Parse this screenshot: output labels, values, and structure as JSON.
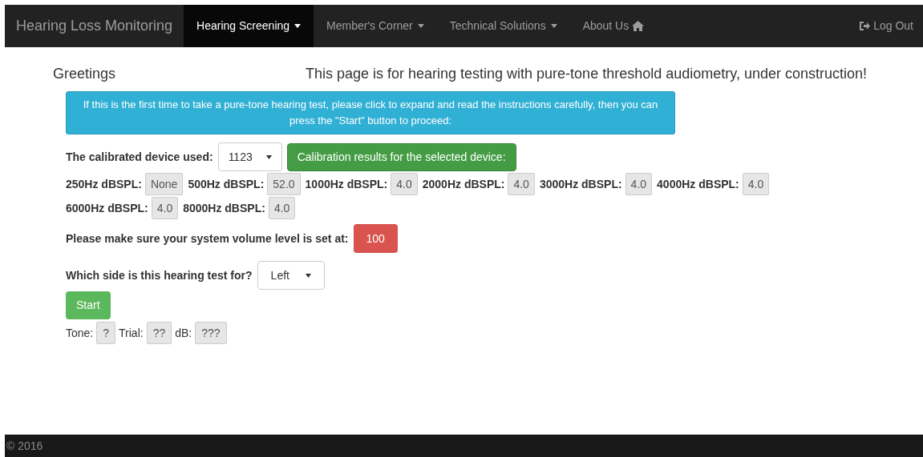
{
  "navbar": {
    "brand": "Hearing Loss Monitoring",
    "items": [
      {
        "label": "Hearing Screening",
        "kind": "dropdown",
        "selected": true
      },
      {
        "label": "Member's Corner",
        "kind": "dropdown",
        "selected": false
      },
      {
        "label": "Technical Solutions",
        "kind": "dropdown",
        "selected": false
      },
      {
        "label": "About Us",
        "kind": "home",
        "selected": false
      }
    ],
    "logout": "Log Out"
  },
  "greeting": "Greetings",
  "notice": "This page is for hearing testing with pure-tone threshold audiometry, under construction!",
  "instructions": "If this is the first time to take a pure-tone hearing test, please click to expand and read the instructions carefully, then you can press the \"Start\" button to proceed:",
  "device": {
    "label": "The calibrated device used:",
    "value": "1123",
    "button": "Calibration results for the selected device:"
  },
  "calibration": [
    {
      "label": "250Hz dBSPL:",
      "value": "None"
    },
    {
      "label": "500Hz dBSPL:",
      "value": "52.0"
    },
    {
      "label": "1000Hz dBSPL:",
      "value": "4.0"
    },
    {
      "label": "2000Hz dBSPL:",
      "value": "4.0"
    },
    {
      "label": "3000Hz dBSPL:",
      "value": "4.0"
    },
    {
      "label": "4000Hz dBSPL:",
      "value": "4.0"
    },
    {
      "label": "6000Hz dBSPL:",
      "value": "4.0"
    },
    {
      "label": "8000Hz dBSPL:",
      "value": "4.0"
    }
  ],
  "volume": {
    "label": "Please make sure your system volume level is set at:",
    "value": "100"
  },
  "side": {
    "label": "Which side is this hearing test for?",
    "value": "Left"
  },
  "start_button": "Start",
  "status": [
    {
      "label": "Tone:",
      "value": "?"
    },
    {
      "label": "Trial:",
      "value": "??"
    },
    {
      "label": "dB:",
      "value": "???"
    }
  ],
  "footer": "© 2016"
}
